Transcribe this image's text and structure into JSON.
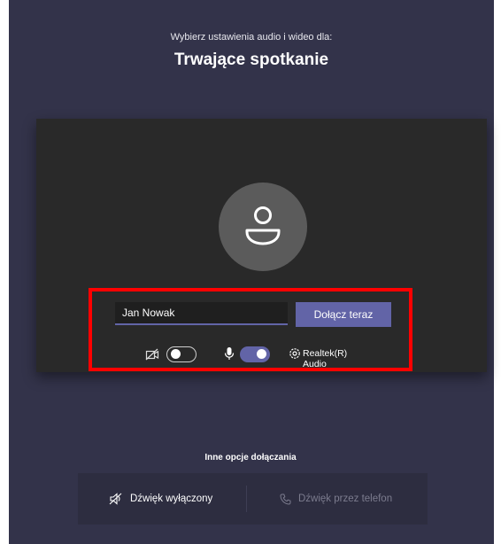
{
  "header": {
    "subtitle": "Wybierz ustawienia audio i wideo dla:",
    "meeting_title": "Trwające spotkanie"
  },
  "prejoin": {
    "name_value": "Jan Nowak",
    "join_button": "Dołącz teraz",
    "camera": {
      "icon": "camera-off-icon",
      "enabled": false
    },
    "microphone": {
      "icon": "microphone-icon",
      "enabled": true
    },
    "audio_device": {
      "icon": "gear-icon",
      "label": "Realtek(R) Audio"
    }
  },
  "other_options": {
    "title": "Inne opcje dołączania",
    "audio_off": {
      "icon": "speaker-off-icon",
      "label": "Dźwięk wyłączony"
    },
    "phone_audio": {
      "icon": "phone-icon",
      "label": "Dźwięk przez telefon"
    }
  },
  "colors": {
    "background": "#33334a",
    "preview": "#292929",
    "accent": "#6264a7",
    "highlight": "#ff0000"
  }
}
